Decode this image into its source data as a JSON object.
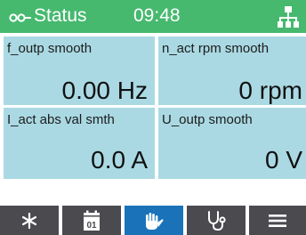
{
  "header": {
    "title": "Status",
    "time": "09:48",
    "background_color": "#46b96f",
    "status_icon": "glasses-icon",
    "network_icon": "network-topology-icon"
  },
  "parameters": [
    {
      "label": "f_outp smooth",
      "value": "0.00 Hz"
    },
    {
      "label": "n_act rpm smooth",
      "value": "0 rpm"
    },
    {
      "label": "I_act abs val smth",
      "value": "0.0 A"
    },
    {
      "label": "U_outp smooth",
      "value": "0 V"
    }
  ],
  "cell_color": "#aad9e3",
  "toolbar": {
    "button_color": "#4a4a4f",
    "active_color": "#1a73b8",
    "active_index": 2,
    "items": [
      {
        "icon": "asterisk-icon"
      },
      {
        "icon": "calendar-01-icon",
        "text": "01"
      },
      {
        "icon": "hand-icon"
      },
      {
        "icon": "stethoscope-icon"
      },
      {
        "icon": "menu-icon"
      }
    ]
  }
}
